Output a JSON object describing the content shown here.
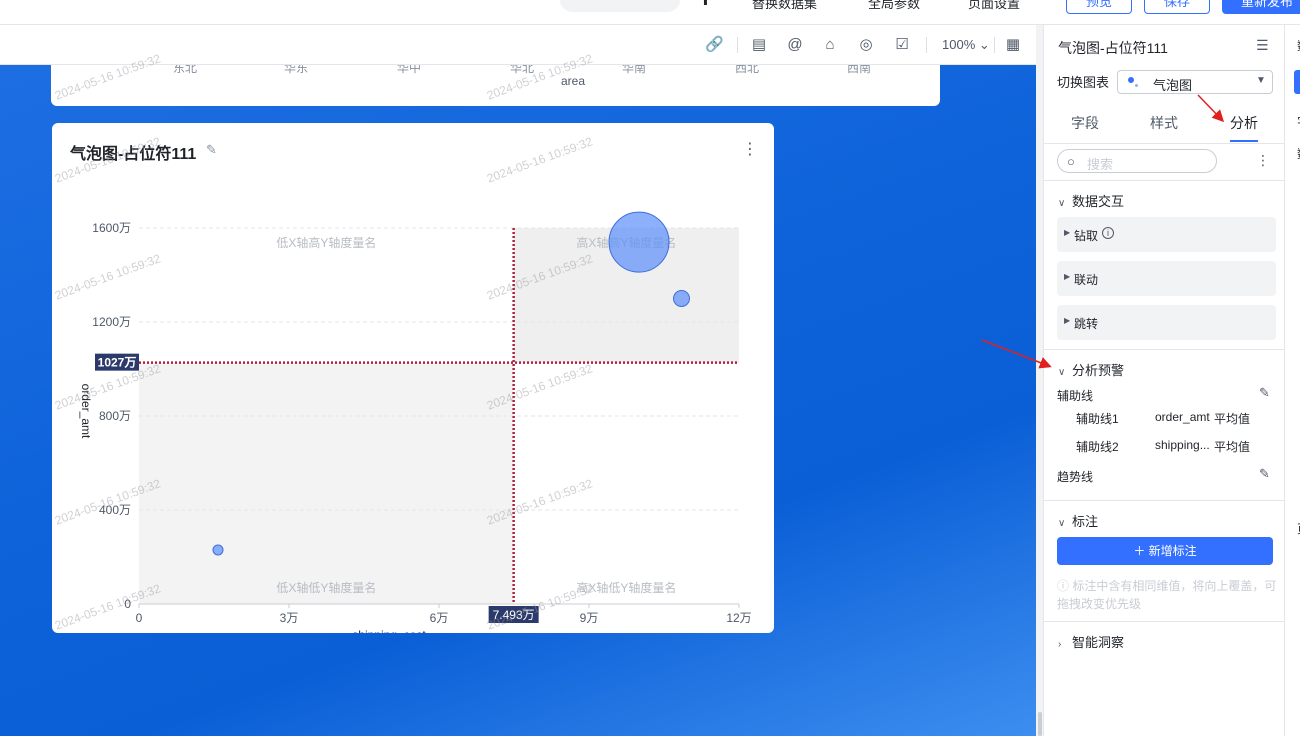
{
  "topbar": {
    "items": [
      "替换数据集",
      "全局参数",
      "页面设置"
    ],
    "buttons": {
      "preview": "预览",
      "save": "保存",
      "publish": "重新发布"
    }
  },
  "canvas_toolbar": {
    "icons": [
      "link-icon",
      "document-icon",
      "mention-icon",
      "building-icon",
      "hide-icon",
      "checklist-icon"
    ],
    "zoom": "100%",
    "layout_icon": "layout-icon"
  },
  "top_card": {
    "x_labels": [
      "东北",
      "华东",
      "华中",
      "华北",
      "华南",
      "西北",
      "西南"
    ],
    "axis_label": "area"
  },
  "watermark": "2024-05-16 10:59:32",
  "chart_card": {
    "title": "气泡图-占位符111"
  },
  "chart_data": {
    "type": "scatter",
    "title": "气泡图-占位符111",
    "xlabel": "shipping_cost",
    "ylabel": "order_amt",
    "xlim": [
      0,
      120000
    ],
    "ylim": [
      0,
      16000000
    ],
    "x_ticks": [
      "0",
      "3万",
      "6万",
      "9万",
      "12万"
    ],
    "y_ticks": [
      "0",
      "400万",
      "800万",
      "1200万",
      "1600万"
    ],
    "points": [
      {
        "x": 15800,
        "y": 2300000,
        "size": 5
      },
      {
        "x": 100000,
        "y": 15400000,
        "size": 30
      },
      {
        "x": 108500,
        "y": 13000000,
        "size": 8
      }
    ],
    "reference_lines": [
      {
        "axis": "y",
        "value": 10270000,
        "label": "1027万"
      },
      {
        "axis": "x",
        "value": 74930,
        "label": "7.493万"
      }
    ],
    "quadrant_labels": {
      "top_left": "低X轴高Y轴度量名",
      "top_right": "高X轴高Y轴度量名",
      "bottom_left": "低X轴低Y轴度量名",
      "bottom_right": "高X轴低Y轴度量名"
    },
    "grid": true,
    "colors": {
      "bubble": "#5b8ff9",
      "reference_line": "#b0213e",
      "ref_label_bg": "#2b3a6b"
    }
  },
  "panel": {
    "title": "气泡图-占位符111",
    "switch_label": "切换图表",
    "chart_type": "气泡图",
    "tabs": [
      "字段",
      "样式",
      "分析"
    ],
    "active_tab": "分析",
    "search_placeholder": "搜索",
    "sections": {
      "data_interaction": "数据交互",
      "drill": "钻取",
      "linkage": "联动",
      "jump": "跳转",
      "analysis_warning": "分析预警",
      "aux_line": "辅助线",
      "aux_lines": [
        {
          "name": "辅助线1",
          "field": "order_amt",
          "type": "平均值"
        },
        {
          "name": "辅助线2",
          "field": "shipping...",
          "type": "平均值"
        }
      ],
      "trend_line": "趋势线",
      "annotation": "标注",
      "add_annotation": "新增标注",
      "hint": "标注中含有相同维值，将向上覆盖，可拖拽改变优先级",
      "smart_insight": "智能洞察"
    }
  },
  "far_panel": {
    "chars": [
      "数",
      "字",
      "数",
      "页",
      "面"
    ]
  }
}
